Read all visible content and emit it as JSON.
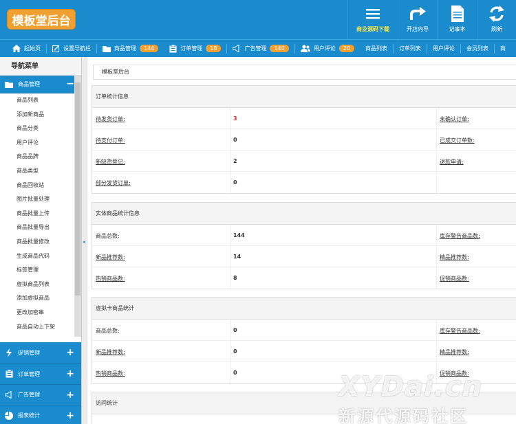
{
  "header": {
    "logo": "模板堂后台",
    "buttons": [
      {
        "label": "商业源码下载",
        "icon": "menu-icon"
      },
      {
        "label": "开店向导",
        "icon": "redo-arrow-icon"
      },
      {
        "label": "记事本",
        "icon": "notepad-icon"
      },
      {
        "label": "刷新",
        "icon": "refresh-icon"
      }
    ]
  },
  "topnav": {
    "items": [
      {
        "label": "起始页",
        "icon": "home-icon"
      },
      {
        "label": "设置导航栏",
        "icon": "edit-icon"
      },
      {
        "label": "商品管理",
        "icon": "folder-icon",
        "badge": "144"
      },
      {
        "label": "订单管理",
        "icon": "clipboard-icon",
        "badge": "18"
      },
      {
        "label": "广告管理",
        "icon": "megaphone-icon",
        "badge": "140"
      },
      {
        "label": "用户评论",
        "icon": "users-icon",
        "badge": "20"
      },
      {
        "label": "商品列表"
      },
      {
        "label": "订单列表"
      },
      {
        "label": "用户评论"
      },
      {
        "label": "会员列表"
      },
      {
        "label": "商"
      }
    ]
  },
  "sidebar": {
    "title": "导航菜单",
    "open_section": {
      "label": "商品管理",
      "toggle": "−"
    },
    "items": [
      "商品列表",
      "添加新商品",
      "商品分类",
      "用户评论",
      "商品品牌",
      "商品类型",
      "商品回收站",
      "图片批量处理",
      "商品批量上传",
      "商品批量导出",
      "商品批量修改",
      "生成商品代码",
      "标签管理",
      "虚拟商品列表",
      "添加虚拟商品",
      "更改加密串",
      "商品自动上下架"
    ],
    "sections": [
      {
        "label": "促销管理",
        "toggle": "+"
      },
      {
        "label": "订单管理",
        "toggle": "+"
      },
      {
        "label": "广告管理",
        "toggle": "+"
      },
      {
        "label": "报表统计",
        "toggle": "+"
      }
    ]
  },
  "breadcrumb": "模板堂后台",
  "panels": [
    {
      "title": "订单统计信息",
      "rows": [
        {
          "label": "待发货订单:",
          "value": "3",
          "right": "未确认订单:"
        },
        {
          "label": "待支付订单:",
          "value": "0",
          "right": "已成交订单数:"
        },
        {
          "label": "新缺货登记:",
          "value": "2",
          "right": "退款申请:"
        },
        {
          "label": "部分发货订单:",
          "value": "0",
          "right": ""
        }
      ]
    },
    {
      "title": "实体商品统计信息",
      "rows": [
        {
          "label": "商品总数:",
          "value": "144",
          "right": "库存警告商品数:"
        },
        {
          "label": "新品推荐数:",
          "value": "14",
          "right": "精品推荐数:"
        },
        {
          "label": "热销商品数:",
          "value": "8",
          "right": "促销商品数:"
        }
      ]
    },
    {
      "title": "虚拟卡商品统计",
      "rows": [
        {
          "label": "商品总数:",
          "value": "0",
          "right": "库存警告商品数:"
        },
        {
          "label": "新品推荐数:",
          "value": "0",
          "right": "精品推荐数:"
        },
        {
          "label": "热销商品数:",
          "value": "0",
          "right": "促销商品数:"
        }
      ]
    },
    {
      "title": "访问统计",
      "rows": []
    }
  ],
  "watermark": {
    "line1": "XYDai.cn",
    "line2": "新源代源码社区"
  }
}
